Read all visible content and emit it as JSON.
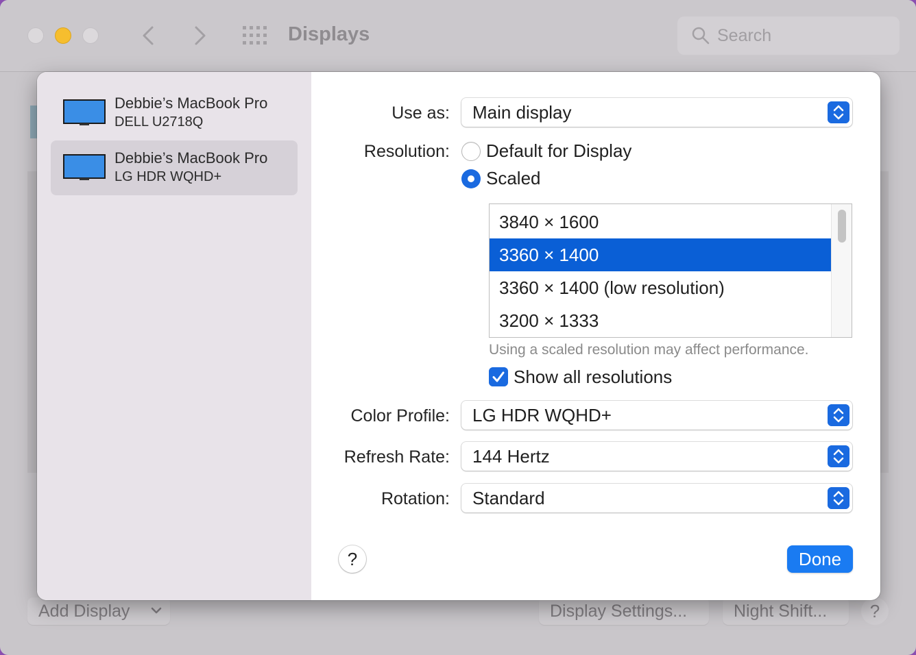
{
  "window": {
    "title": "Displays",
    "search_placeholder": "Search"
  },
  "background_buttons": {
    "add_display": "Add Display",
    "display_settings": "Display Settings...",
    "night_shift": "Night Shift...",
    "help": "?"
  },
  "sidebar": {
    "items": [
      {
        "name": "Debbie’s MacBook Pro",
        "subtitle": "DELL U2718Q",
        "selected": false
      },
      {
        "name": "Debbie’s MacBook Pro",
        "subtitle": "LG HDR WQHD+",
        "selected": true
      }
    ]
  },
  "settings": {
    "use_as": {
      "label": "Use as:",
      "value": "Main display"
    },
    "resolution": {
      "label": "Resolution:",
      "options": [
        {
          "label": "Default for Display",
          "selected": false
        },
        {
          "label": "Scaled",
          "selected": true
        }
      ],
      "list": [
        "3840 × 1600",
        "3360 × 1400",
        "3360 × 1400 (low resolution)",
        "3200 × 1333"
      ],
      "selected_index": 1,
      "note": "Using a scaled resolution may affect performance.",
      "show_all": {
        "label": "Show all resolutions",
        "checked": true
      }
    },
    "color_profile": {
      "label": "Color Profile:",
      "value": "LG HDR WQHD+"
    },
    "refresh_rate": {
      "label": "Refresh Rate:",
      "value": "144 Hertz"
    },
    "rotation": {
      "label": "Rotation:",
      "value": "Standard"
    }
  },
  "footer": {
    "help": "?",
    "done": "Done"
  },
  "colors": {
    "accent": "#1a6ae0",
    "selection": "#0a5fd6",
    "done_button": "#1a7bf2",
    "traffic_minimize": "#f6be2e"
  }
}
